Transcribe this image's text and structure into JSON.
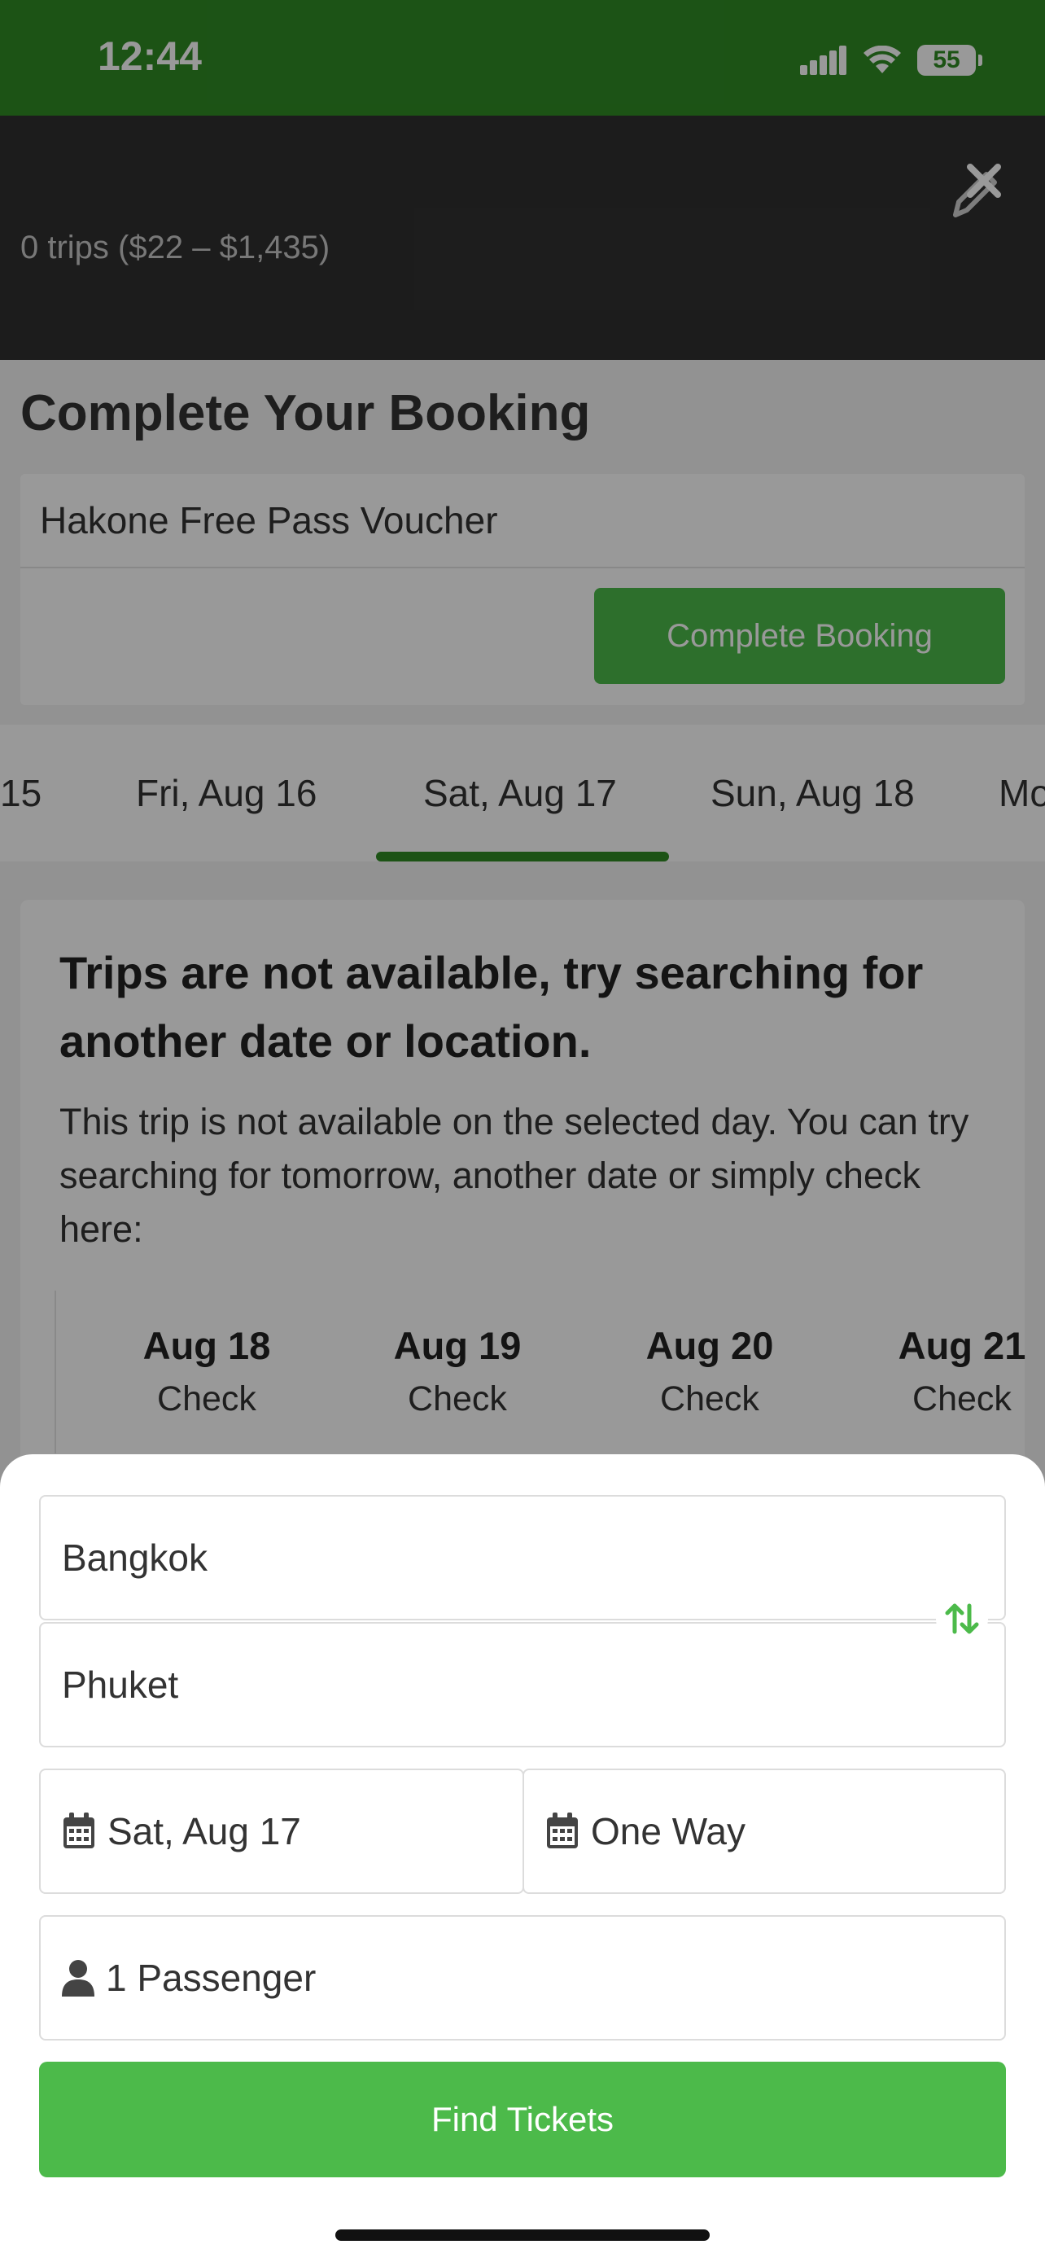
{
  "status_bar": {
    "time": "12:44",
    "battery": "55"
  },
  "header": {
    "trips_summary": "0 trips ($22 – $1,435)"
  },
  "booking": {
    "title": "Complete Your Booking",
    "voucher": "Hakone Free Pass Voucher",
    "complete_button": "Complete Booking"
  },
  "date_tabs": {
    "items": [
      "15",
      "Fri, Aug 16",
      "Sat, Aug 17",
      "Sun, Aug 18",
      "Mo"
    ],
    "selected": "Sat, Aug 17"
  },
  "notice": {
    "title": "Trips are not available, try searching for another date or location.",
    "body": "This trip is not available on the selected day. You can try searching for tomorrow, another date or simply check here:",
    "alt_dates": [
      {
        "date": "Aug 18",
        "action": "Check"
      },
      {
        "date": "Aug 19",
        "action": "Check"
      },
      {
        "date": "Aug 20",
        "action": "Check"
      },
      {
        "date": "Aug 21",
        "action": "Check"
      }
    ]
  },
  "search": {
    "from": "Bangkok",
    "to": "Phuket",
    "date": "Sat, Aug 17",
    "return": "One Way",
    "passengers": "1 Passenger",
    "find_button": "Find Tickets"
  },
  "colors": {
    "brand_green": "#2f8a24",
    "button_green": "#4cba4a",
    "header_dark": "#303030"
  },
  "icons": [
    "signal-icon",
    "wifi-icon",
    "battery-icon",
    "close-icon",
    "pencil-icon",
    "swap-icon",
    "calendar-icon",
    "user-icon"
  ]
}
